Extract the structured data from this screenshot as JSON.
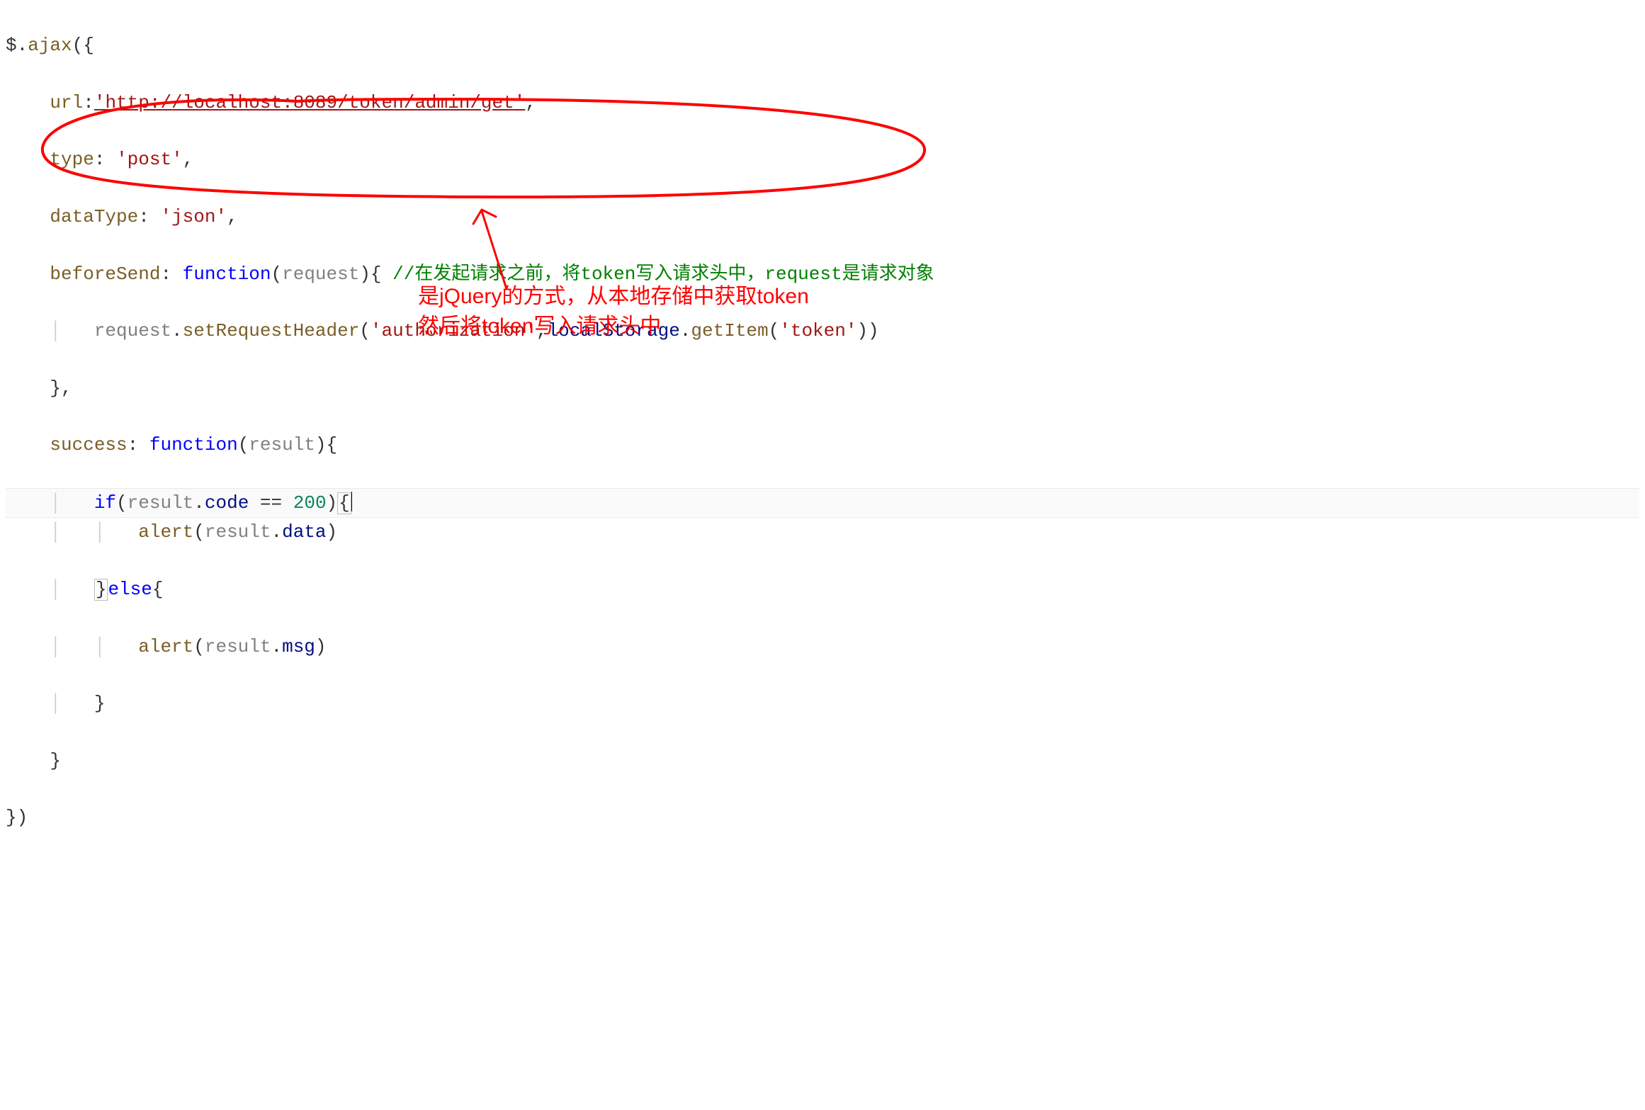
{
  "code": {
    "line1_a": "$.",
    "line1_b": "ajax",
    "line1_c": "({",
    "line2_key": "url",
    "line2_colon": ":",
    "line2_str": "'http://localhost:8089/token/admin/get'",
    "line2_end": ",",
    "line3_key": "type",
    "line3_rest": ": ",
    "line3_str": "'post'",
    "line3_end": ",",
    "line4_key": "dataType",
    "line4_rest": ": ",
    "line4_str": "'json'",
    "line4_end": ",",
    "line5_key": "beforeSend",
    "line5_rest": ": ",
    "line5_kw": "function",
    "line5_paren_open": "(",
    "line5_param": "request",
    "line5_paren_close_brace": "){ ",
    "line5_comment": "//在发起请求之前，将token写入请求头中，request是请求对象",
    "line6_obj": "request",
    "line6_dot1": ".",
    "line6_m1": "setRequestHeader",
    "line6_paren1": "(",
    "line6_str1": "'authorization'",
    "line6_comma": ",",
    "line6_ls": "localStorage",
    "line6_dot2": ".",
    "line6_m2": "getItem",
    "line6_paren2": "(",
    "line6_str2": "'token'",
    "line6_close": "))",
    "line7": "},",
    "line8_key": "success",
    "line8_rest": ": ",
    "line8_kw": "function",
    "line8_paren_open": "(",
    "line8_param": "result",
    "line8_paren_close_brace": "){",
    "line9_kw": "if",
    "line9_open": "(",
    "line9_obj": "result",
    "line9_dot": ".",
    "line9_prop": "code",
    "line9_eq": " == ",
    "line9_num": "200",
    "line9_close": ")",
    "line9_brace": "{",
    "line10_fn": "alert",
    "line10_open": "(",
    "line10_obj": "result",
    "line10_dot": ".",
    "line10_prop": "data",
    "line10_close": ")",
    "line11_close": "}",
    "line11_kw": "else",
    "line11_open": "{",
    "line12_fn": "alert",
    "line12_open": "(",
    "line12_obj": "result",
    "line12_dot": ".",
    "line12_prop": "msg",
    "line12_close": ")",
    "line13": "}",
    "line14": "}",
    "line15": "})"
  },
  "annotation": {
    "line1": "是jQuery的方式，从本地存储中获取token",
    "line2": "然后将token写入请求头中"
  }
}
